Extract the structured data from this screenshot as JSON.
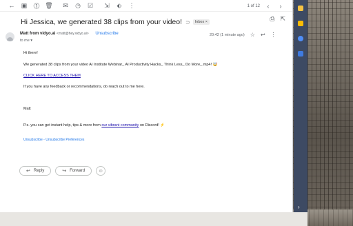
{
  "toolbar": {
    "pager_text": "1 of 12"
  },
  "email": {
    "subject": "Hi Jessica, we generated 38 clips from your video!",
    "label": "Inbox ×",
    "sender_name": "Matt from vidyo.ai",
    "sender_email": "<matt@hey.vidyo.ai>",
    "unsubscribe": "Unsubscribe",
    "to": "to me ▾",
    "time": "20:42 (1 minute ago)",
    "greeting": "Hi there!",
    "line1": "We generated 38 clips from your video AI Institute Webinar_ AI Productivity Hacks_ Think Less_ Do More_.mp4! 🤯",
    "cta_link": "CLICK HERE TO ACCESS THEM",
    "line2": "If you have any feedback or recommendations, do reach out to me here.",
    "signature": "Matt",
    "ps_prefix": "P.s. you can get instant help, tips & more from ",
    "ps_link": "our vibrant community",
    "ps_suffix": " on Discord! ⚡",
    "footer_links": "Unsubscribe - Unsubscribe Preferences"
  },
  "actions": {
    "reply_label": "Reply",
    "forward_label": "Forward"
  },
  "colors": {
    "accent_link": "#1a73e8",
    "side_panel": "#3d4a63"
  }
}
